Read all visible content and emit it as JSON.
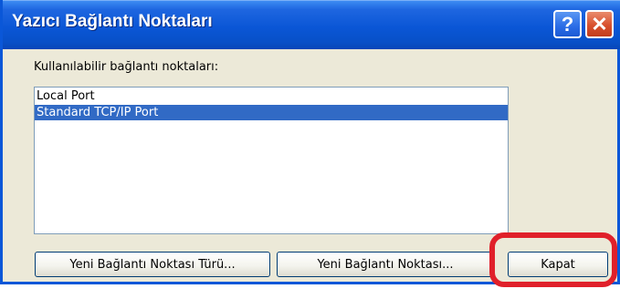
{
  "window": {
    "title": "Yazıcı Bağlantı Noktaları",
    "help_glyph": "?",
    "close_glyph": "✕"
  },
  "ports": {
    "label": "Kullanılabilir bağlantı noktaları:",
    "items": [
      {
        "label": "Local Port",
        "selected": false
      },
      {
        "label": "Standard TCP/IP Port",
        "selected": true
      }
    ]
  },
  "buttons": {
    "new_port_type": "Yeni Bağlantı Noktası Türü...",
    "new_port": "Yeni Bağlantı Noktası...",
    "close": "Kapat"
  },
  "colors": {
    "titlebar": "#0a56d6",
    "selection": "#316ac5",
    "highlight_outline": "#e0202a"
  }
}
